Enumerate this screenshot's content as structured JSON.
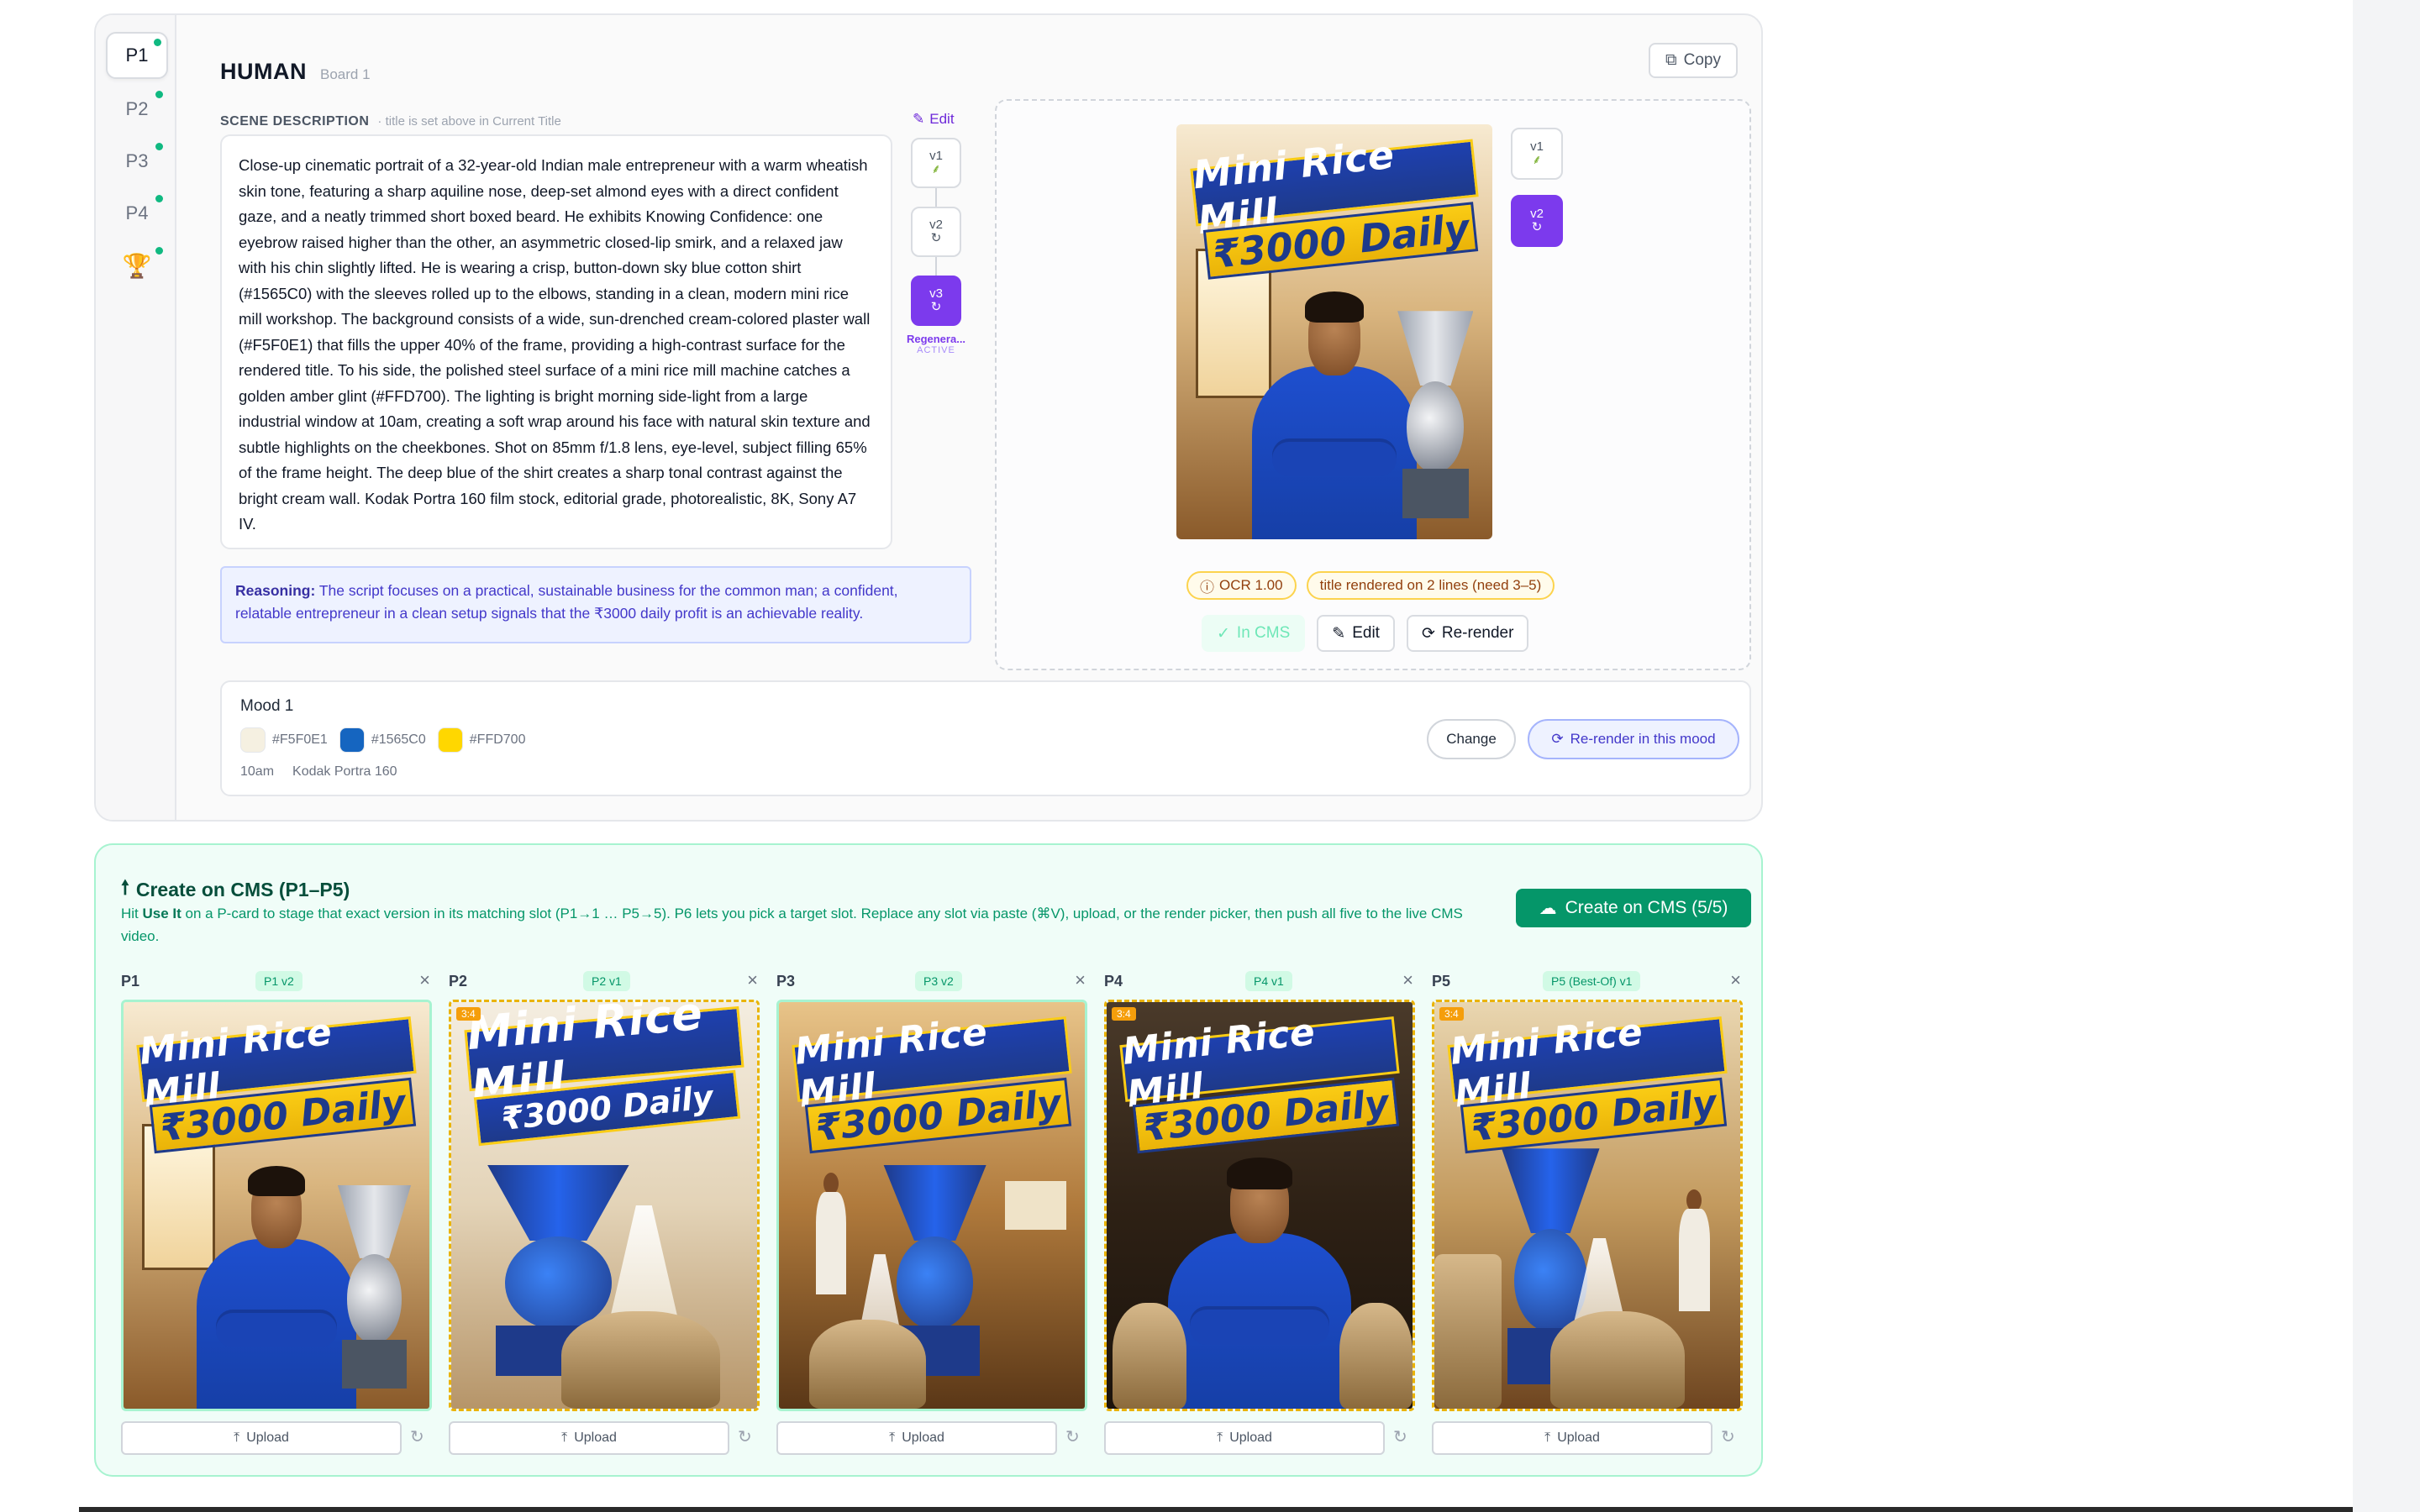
{
  "rail": {
    "items": [
      {
        "label": "P1",
        "active": true
      },
      {
        "label": "P2",
        "active": false
      },
      {
        "label": "P3",
        "active": false
      },
      {
        "label": "P4",
        "active": false
      },
      {
        "label": "🏆",
        "active": false
      }
    ]
  },
  "board": {
    "title": "HUMAN",
    "subtitle": "Board 1",
    "copy_label": "Copy"
  },
  "scene": {
    "label": "SCENE DESCRIPTION",
    "hint": "· title is set above in Current Title",
    "edit_label": "Edit",
    "text": "Close-up cinematic portrait of a 32-year-old Indian male entrepreneur with a warm wheatish skin tone, featuring a sharp aquiline nose, deep-set almond eyes with a direct confident gaze, and a neatly trimmed short boxed beard. He exhibits Knowing Confidence: one eyebrow raised higher than the other, an asymmetric closed-lip smirk, and a relaxed jaw with his chin slightly lifted. He is wearing a crisp, button-down sky blue cotton shirt (#1565C0) with the sleeves rolled up to the elbows, standing in a clean, modern mini rice mill workshop. The background consists of a wide, sun-drenched cream-colored plaster wall (#F5F0E1) that fills the upper 40% of the frame, providing a high-contrast surface for the rendered title. To his side, the polished steel surface of a mini rice mill machine catches a golden amber glint (#FFD700). The lighting is bright morning side-light from a large industrial window at 10am, creating a soft wrap around his face with natural skin texture and subtle highlights on the cheekbones. Shot on 85mm f/1.8 lens, eye-level, subject filling 65% of the frame height. The deep blue of the shirt creates a sharp tonal contrast against the bright cream wall. Kodak Portra 160 film stock, editorial grade, photorealistic, 8K, Sony A7 IV."
  },
  "versions": {
    "items": [
      {
        "label": "v1",
        "icon": "sprout-icon",
        "active": false
      },
      {
        "label": "v2",
        "icon": "refresh-icon",
        "active": false
      },
      {
        "label": "v3",
        "icon": "refresh-icon",
        "active": true
      }
    ],
    "active_caption": "Regenera...",
    "active_status": "ACTIVE"
  },
  "reasoning": {
    "label": "Reasoning:",
    "text": "The script focuses on a practical, sustainable business for the common man; a confident, relatable entrepreneur in a clean setup signals that the ₹3000 daily profit is an achievable reality."
  },
  "preview": {
    "poster_line1": "Mini Rice Mill",
    "poster_line2": "₹3000 Daily",
    "versions": [
      {
        "label": "v1",
        "active": false
      },
      {
        "label": "v2",
        "active": true
      }
    ],
    "ocr_badge": "OCR 1.00",
    "lines_badge": "title rendered on 2 lines (need 3–5)",
    "in_cms_label": "In CMS",
    "edit_label": "Edit",
    "rerender_label": "Re-render"
  },
  "mood": {
    "title": "Mood 1",
    "swatches": [
      {
        "hex": "#F5F0E1",
        "color": "#F5F0E1"
      },
      {
        "hex": "#1565C0",
        "color": "#1565C0"
      },
      {
        "hex": "#FFD700",
        "color": "#FFD700"
      }
    ],
    "time": "10am",
    "film": "Kodak Portra 160",
    "change_label": "Change",
    "rerender_label": "Re-render in this mood"
  },
  "cms": {
    "title": "Create on CMS (P1–P5)",
    "desc_pre": "Hit ",
    "desc_bold": "Use It",
    "desc_post": " on a P-card to stage that exact version in its matching slot (P1→1 … P5→5). P6 lets you pick a target slot. Replace any slot via paste (⌘V), upload, or the render picker, then push all five to the live CMS video.",
    "create_label": "Create on CMS (5/5)",
    "upload_label": "Upload",
    "slots": [
      {
        "label": "P1",
        "tag": "P1 v2",
        "ratio": "",
        "line1": "Mini Rice Mill",
        "line2": "₹3000 Daily"
      },
      {
        "label": "P2",
        "tag": "P2 v1",
        "ratio": "3:4",
        "line1": "Mini Rice Mill",
        "line2": "₹3000 Daily"
      },
      {
        "label": "P3",
        "tag": "P3 v2",
        "ratio": "",
        "line1": "Mini Rice Mill",
        "line2": "₹3000 Daily"
      },
      {
        "label": "P4",
        "tag": "P4 v1",
        "ratio": "3:4",
        "line1": "Mini Rice Mill",
        "line2": "₹3000 Daily"
      },
      {
        "label": "P5",
        "tag": "P5 (Best-Of) v1",
        "ratio": "3:4",
        "line1": "Mini Rice Mill",
        "line2": "₹3000 Daily"
      }
    ]
  },
  "colors": {
    "accent": "#7c3aed",
    "success": "#059669",
    "warning": "#f59e0b"
  }
}
